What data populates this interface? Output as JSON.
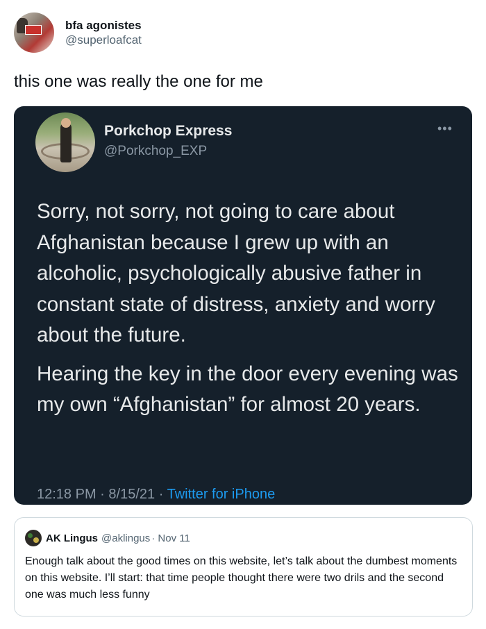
{
  "outer_tweet": {
    "author_name": "bfa agonistes",
    "author_handle": "@superloafcat",
    "text": "this one was really the one for me"
  },
  "embedded_tweet": {
    "author_name": "Porkchop Express",
    "author_handle": "@Porkchop_EXP",
    "more_label": "•••",
    "paragraphs": [
      "Sorry, not sorry, not going to care about Afghanistan because I grew up with an alcoholic, psychologically abusive father in constant state of distress, anxiety and worry about the future.",
      "Hearing the key in the door every evening was my own “Afghanistan” for almost 20 years."
    ],
    "time": "12:18 PM",
    "separator": "·",
    "date": "8/15/21",
    "source": "Twitter for iPhone"
  },
  "quoted_tweet": {
    "author_name": "AK Lingus",
    "author_handle": "@aklingus",
    "date": "· Nov 11",
    "text": "Enough talk about the good times on this website, let’s talk about the dumbest moments on this website. I’ll start: that time people thought there were two drils and the second one was much less funny"
  },
  "colors": {
    "dark_card_bg": "#15202b",
    "link_blue": "#1d9bf0",
    "muted_gray": "#536471"
  }
}
